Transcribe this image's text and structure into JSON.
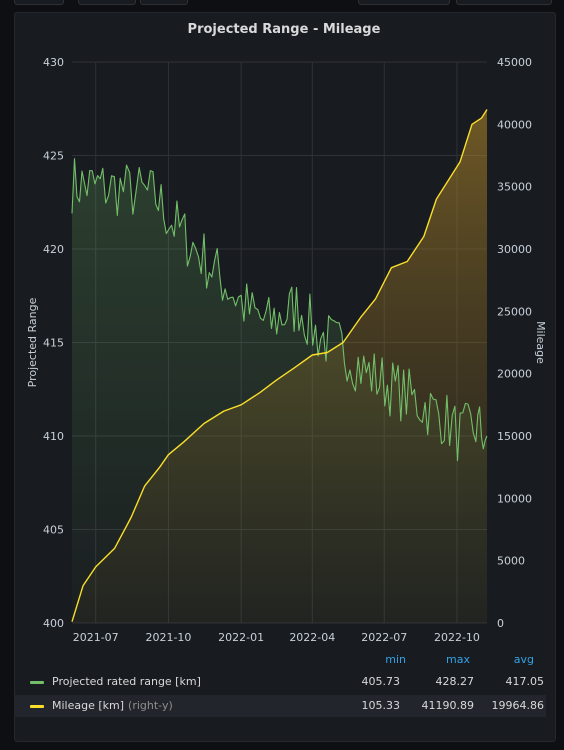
{
  "colors": {
    "range": "#73bf69",
    "mileage": "#fade2a",
    "grid": "#2f3238",
    "text": "#c7d0d9",
    "header": "#33a2e5"
  },
  "panel": {
    "title": "Projected Range - Mileage"
  },
  "legend": {
    "headers": {
      "min": "min",
      "max": "max",
      "avg": "avg"
    },
    "rows": [
      {
        "label": "Projected rated range [km]",
        "suffix": "",
        "min": "405.73",
        "max": "428.27",
        "avg": "417.05"
      },
      {
        "label": "Mileage [km]",
        "suffix": "(right-y)",
        "min": "105.33",
        "max": "41190.89",
        "avg": "19964.86"
      }
    ]
  },
  "chart_data": {
    "type": "line",
    "title": "Projected Range - Mileage",
    "x_range": [
      "2021-06-01",
      "2022-11-08"
    ],
    "x_ticks": [
      "2021-07",
      "2021-10",
      "2022-01",
      "2022-04",
      "2022-07",
      "2022-10"
    ],
    "x_tick_dates": [
      "2021-07-01",
      "2021-10-01",
      "2022-01-01",
      "2022-04-01",
      "2022-07-01",
      "2022-10-01"
    ],
    "ylabel_left": "Projected Range",
    "ylabel_right": "Mileage",
    "ylim_left": [
      400,
      430
    ],
    "yticks_left": [
      400,
      405,
      410,
      415,
      420,
      425,
      430
    ],
    "ylim_right": [
      0,
      45000
    ],
    "yticks_right": [
      0,
      5000,
      10000,
      15000,
      20000,
      25000,
      30000,
      35000,
      40000,
      45000
    ],
    "grid": true,
    "legend_position": "bottom",
    "series": [
      {
        "name": "Projected rated range [km]",
        "axis": "left",
        "x": [
          "2021-06-01",
          "2021-06-20",
          "2021-07-10",
          "2021-08-01",
          "2021-08-25",
          "2021-09-15",
          "2021-10-05",
          "2021-10-25",
          "2021-11-15",
          "2021-12-05",
          "2021-12-25",
          "2022-01-15",
          "2022-02-05",
          "2022-02-25",
          "2022-03-15",
          "2022-04-05",
          "2022-04-25",
          "2022-05-15",
          "2022-06-05",
          "2022-06-25",
          "2022-07-15",
          "2022-08-05",
          "2022-08-25",
          "2022-09-15",
          "2022-10-05",
          "2022-10-25",
          "2022-11-08"
        ],
        "values": [
          423.5,
          423.4,
          423.3,
          423.2,
          423.0,
          422.8,
          421.5,
          420.5,
          419.5,
          418.5,
          417.5,
          416.5,
          416.0,
          416.5,
          417.0,
          415.5,
          415.0,
          414.5,
          413.5,
          413.0,
          412.5,
          412.0,
          411.5,
          411.0,
          410.0,
          410.5,
          410.0
        ]
      },
      {
        "name": "Mileage [km]",
        "axis": "right",
        "x": [
          "2021-06-01",
          "2021-06-15",
          "2021-07-01",
          "2021-07-25",
          "2021-08-15",
          "2021-09-01",
          "2021-09-20",
          "2021-10-01",
          "2021-10-20",
          "2021-11-15",
          "2021-12-10",
          "2022-01-01",
          "2022-01-25",
          "2022-02-15",
          "2022-03-10",
          "2022-04-01",
          "2022-04-20",
          "2022-05-10",
          "2022-06-01",
          "2022-06-20",
          "2022-07-10",
          "2022-07-30",
          "2022-08-20",
          "2022-09-05",
          "2022-09-20",
          "2022-10-05",
          "2022-10-20",
          "2022-11-01",
          "2022-11-08"
        ],
        "values": [
          105.33,
          3000,
          4500,
          6000,
          8500,
          11000,
          12500,
          13500,
          14500,
          16000,
          17000,
          17500,
          18500,
          19500,
          20500,
          21500,
          21700,
          22500,
          24500,
          26000,
          28500,
          29000,
          31000,
          34000,
          35500,
          37000,
          40000,
          40500,
          41190.89
        ]
      }
    ]
  }
}
